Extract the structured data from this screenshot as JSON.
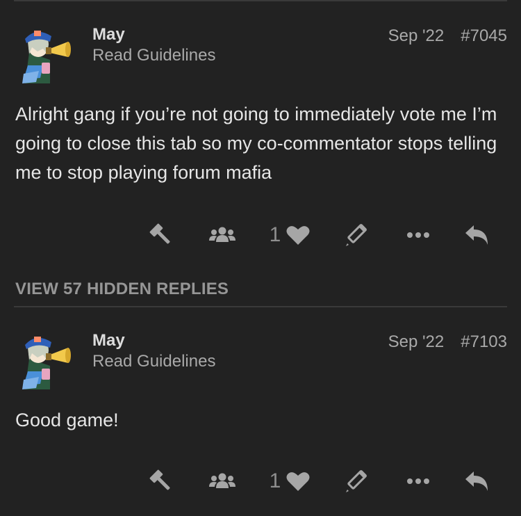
{
  "posts": [
    {
      "username": "May",
      "user_title": "Read Guidelines",
      "date": "Sep '22",
      "post_number": "#7045",
      "body": "Alright gang if you’re not going to immediately vote me I’m going to close this tab so my co-commentator stops telling me to stop playing forum mafia",
      "like_count": "1"
    },
    {
      "username": "May",
      "user_title": "Read Guidelines",
      "date": "Sep '22",
      "post_number": "#7103",
      "body": "Good game!",
      "like_count": "1"
    }
  ],
  "hidden_replies_label": "VIEW 57 HIDDEN REPLIES",
  "icons": {
    "moderator": "gavel-icon",
    "group": "users-icon",
    "like": "heart-icon",
    "edit": "pencil-icon",
    "more": "ellipsis-icon",
    "reply": "reply-arrow-icon"
  },
  "colors": {
    "background": "#222222",
    "text": "#e6e6e6",
    "muted": "#a9a9a9",
    "icon": "#a6a6a6",
    "avatar_hat": "#2f5fb8",
    "avatar_megaphone": "#f2c94c"
  }
}
